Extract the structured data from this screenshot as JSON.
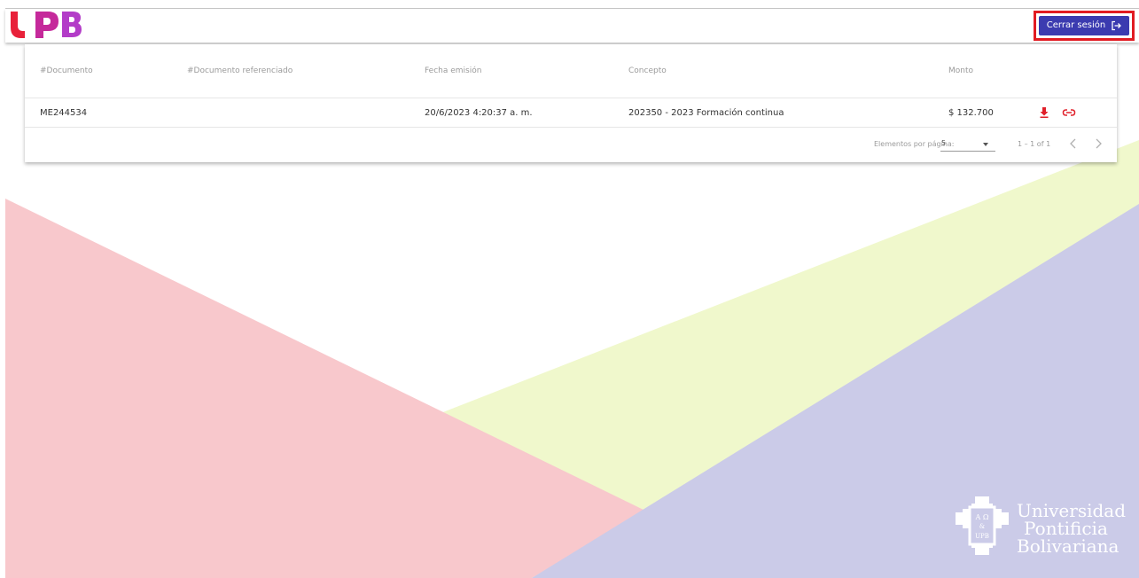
{
  "header": {
    "logo_alt": "UPB",
    "logout_label": "Cerrar sesión",
    "logout_icon": "logout-icon"
  },
  "table": {
    "columns": [
      "#Documento",
      "#Documento referenciado",
      "Fecha emisión",
      "Concepto",
      "Monto"
    ],
    "rows": [
      {
        "documento": "ME244534",
        "referenciado": "",
        "fecha": "20/6/2023 4:20:37 a. m.",
        "concepto": "202350 - 2023 Formación continua",
        "monto": "$ 132.700",
        "actions": [
          "download-icon",
          "link-icon"
        ]
      }
    ]
  },
  "paginator": {
    "label": "Elementos por página:",
    "page_size": "5",
    "range": "1 – 1 of 1"
  },
  "footer_logo": {
    "line1": "Universidad",
    "line2": "Pontificia",
    "line3": "Bolivariana",
    "seal_text": "A Ω UPB"
  },
  "colors": {
    "accent": "#3b3bb0",
    "highlight_border": "#e11b22",
    "icon_red": "#e0202a",
    "bg_pink": "#f8c8cc",
    "bg_yellow": "#f0f8cc",
    "bg_lavender": "#cbcbe8",
    "logo_magenta": "#c5299b"
  }
}
